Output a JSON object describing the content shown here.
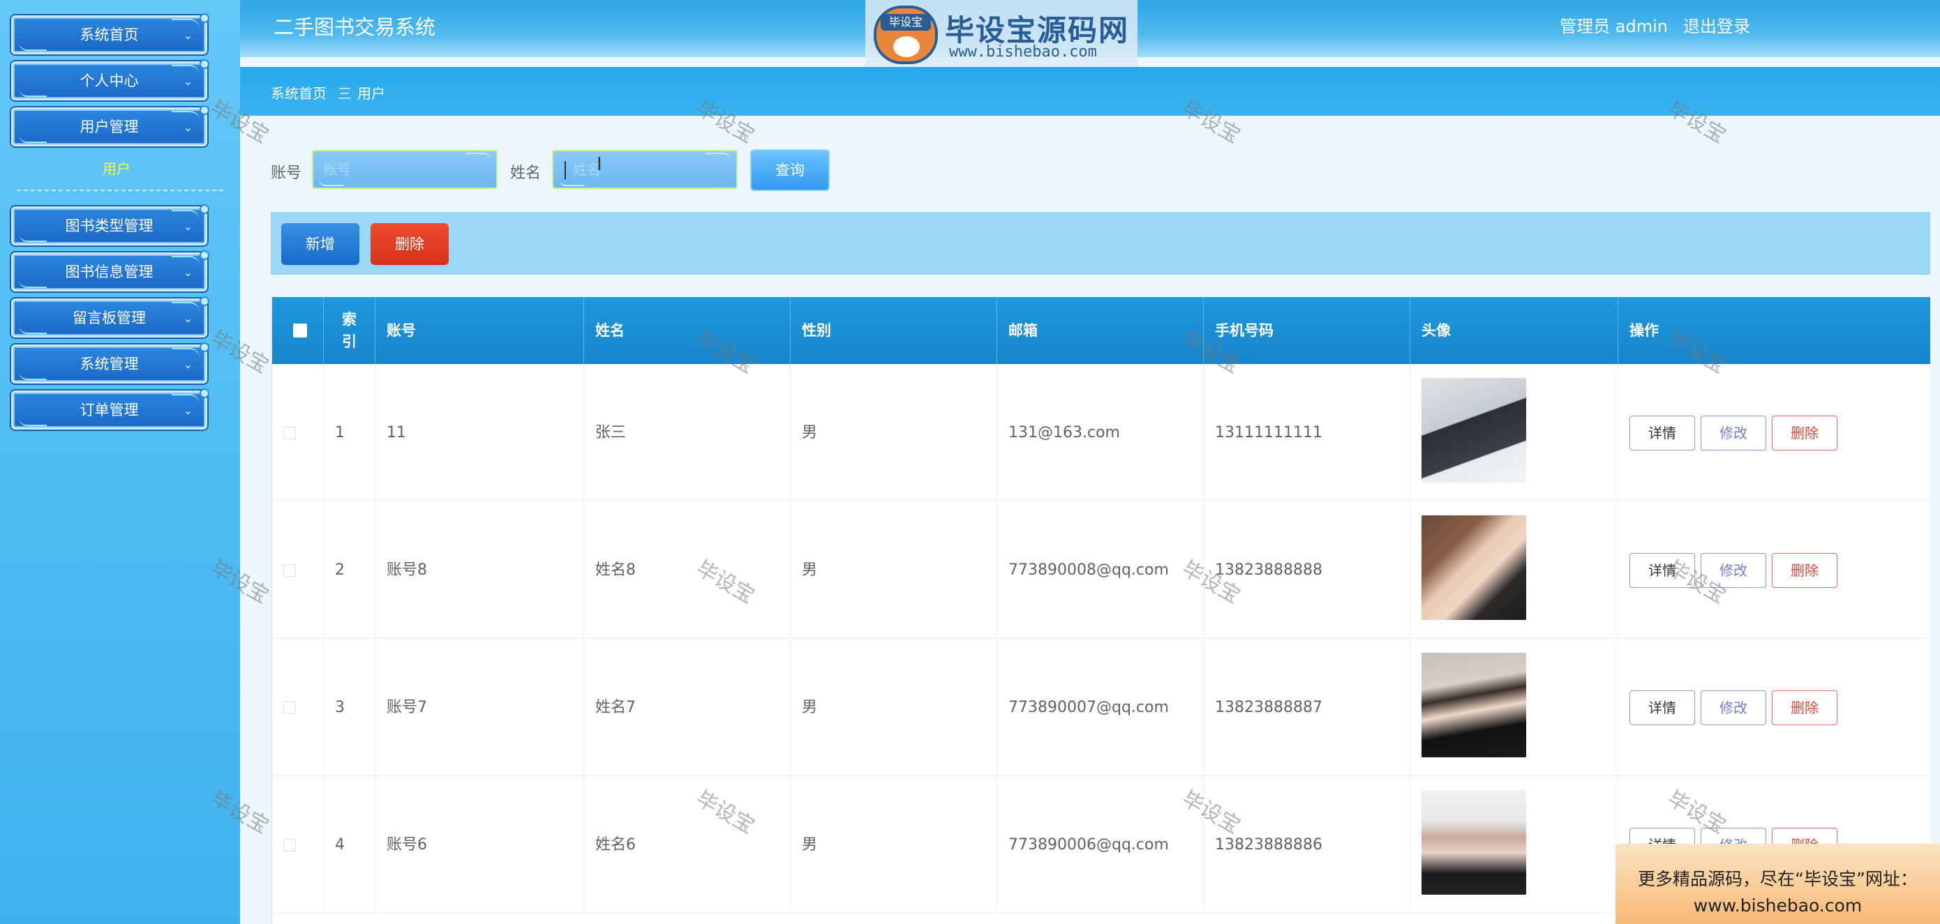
{
  "app": {
    "title": "二手图书交易系统"
  },
  "header": {
    "user_label": "管理员 admin",
    "logout": "退出登录"
  },
  "logo": {
    "band": "毕设宝",
    "name": "毕设宝源码网",
    "url": "www.bishebao.com"
  },
  "sidebar": {
    "items": [
      {
        "label": "系统首页"
      },
      {
        "label": "个人中心"
      },
      {
        "label": "用户管理"
      },
      {
        "label": "图书类型管理"
      },
      {
        "label": "图书信息管理"
      },
      {
        "label": "留言板管理"
      },
      {
        "label": "系统管理"
      },
      {
        "label": "订单管理"
      }
    ],
    "submenu": "用户"
  },
  "breadcrumb": {
    "home": "系统首页",
    "separator": "三",
    "current": "用户"
  },
  "search": {
    "account_label": "账号",
    "account_placeholder": "账号",
    "name_label": "姓名",
    "name_placeholder": "姓名",
    "query_button": "查询"
  },
  "actions": {
    "add": "新增",
    "delete": "删除"
  },
  "table": {
    "headers": [
      "索引",
      "账号",
      "姓名",
      "性别",
      "邮箱",
      "手机号码",
      "头像",
      "操作"
    ],
    "index_header_top": "索",
    "index_header_bottom": "引",
    "rows": [
      {
        "index": "1",
        "account": "11",
        "name": "张三",
        "gender": "男",
        "email": "131@163.com",
        "phone": "13111111111",
        "detail": "详情",
        "edit": "修改",
        "remove": "删除"
      },
      {
        "index": "2",
        "account": "账号8",
        "name": "姓名8",
        "gender": "男",
        "email": "773890008@qq.com",
        "phone": "13823888888",
        "detail": "详情",
        "edit": "修改",
        "remove": "删除"
      },
      {
        "index": "3",
        "account": "账号7",
        "name": "姓名7",
        "gender": "男",
        "email": "773890007@qq.com",
        "phone": "13823888887",
        "detail": "详情",
        "edit": "修改",
        "remove": "删除"
      },
      {
        "index": "4",
        "account": "账号6",
        "name": "姓名6",
        "gender": "男",
        "email": "773890006@qq.com",
        "phone": "13823888886",
        "detail": "详情",
        "edit": "修改",
        "remove": "删除"
      }
    ]
  },
  "watermark": "毕设宝",
  "promo": {
    "line1": "更多精品源码，尽在“毕设宝”网址：",
    "line2": "www.bishebao.com"
  }
}
